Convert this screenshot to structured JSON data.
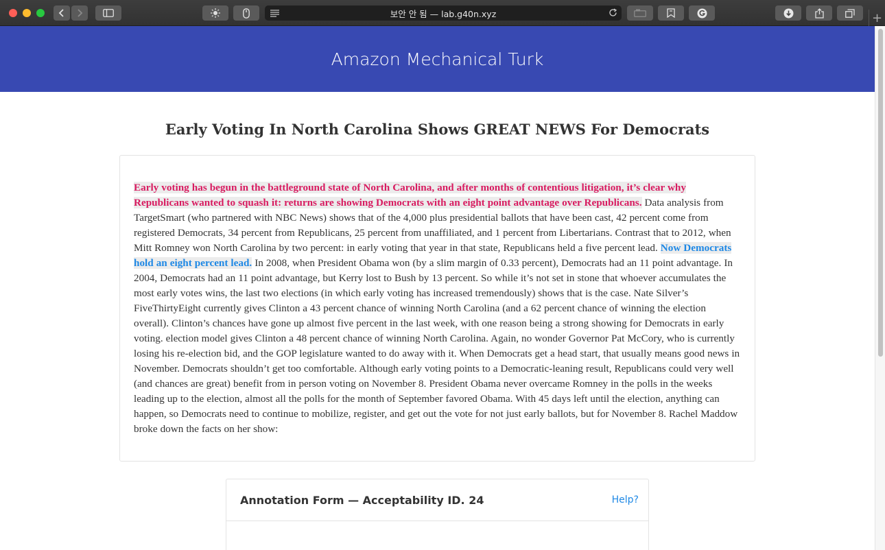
{
  "browser": {
    "url_display": "보안 안 됨 — lab.g40n.xyz",
    "new_tab_label": "+",
    "icons": {
      "back": "chevron-left-icon",
      "forward": "chevron-right-icon",
      "sidebar": "sidebar-icon",
      "brightness": "sun-icon",
      "mouse": "mouse-icon",
      "reader": "reader-lines-icon",
      "reload": "reload-icon",
      "extension_1": "tabs-extension-icon",
      "extension_2": "bookmark-icon",
      "extension_3": "grammarly-icon",
      "download": "download-icon",
      "share": "share-icon",
      "tabs": "tab-overview-icon"
    }
  },
  "page": {
    "banner_title": "Amazon Mechanical Turk",
    "headline": "Early Voting In North Carolina Shows GREAT NEWS For Democrats",
    "article": {
      "highlight_red": "Early voting has begun in the battleground state of North Carolina, and after months of contentious litigation, it’s clear why Republicans wanted to squash it: returns are showing Democrats with an eight point advantage over Republicans.",
      "text_1": " Data analysis from TargetSmart (who partnered with NBC News) shows that of the 4,000 plus presidential ballots that have been cast, 42 percent come from registered Democrats, 34 percent from Republicans, 25 percent from unaffiliated, and 1 percent from Libertarians. Contrast that to 2012, when Mitt Romney won North Carolina by two percent: in early voting that year in that state, Republicans held a five percent lead. ",
      "highlight_blue": "Now Democrats hold an eight percent lead.",
      "text_2": " In 2008, when President Obama won (by a slim margin of 0.33 percent), Democrats had an 11 point advantage. In 2004, Democrats had an 11 point advantage, but Kerry lost to Bush by 13 percent. So while it’s not set in stone that whoever accumulates the most early votes wins, the last two elections (in which early voting has increased tremendously) shows that is the case. Nate Silver’s FiveThirtyEight currently gives Clinton a 43 percent chance of winning North Carolina (and a 62 percent chance of winning the election overall). Clinton’s chances have gone up almost five percent in the last week, with one reason being a strong showing for Democrats in early voting. election model gives Clinton a 48 percent chance of winning North Carolina. Again, no wonder Governor Pat McCory, who is currently losing his re-election bid, and the GOP legislature wanted to do away with it. When Democrats get a head start, that usually means good news in November. Democrats shouldn’t get too comfortable. Although early voting points to a Democratic-leaning result, Republicans could very well (and chances are great) benefit from in person voting on November 8. President Obama never overcame Romney in the polls in the weeks leading up to the election, almost all the polls for the month of September favored Obama. With 45 days left until the election, anything can happen, so Democrats need to continue to mobilize, register, and get out the vote for not just early ballots, but for November 8. Rachel Maddow broke down the facts on her show:"
    },
    "form": {
      "title": "Annotation Form — Acceptability ID. 24",
      "help_label": "Help?"
    }
  },
  "colors": {
    "banner": "#3849b2",
    "highlight_red": "#d81b60",
    "highlight_blue": "#1e88e5",
    "link": "#1e88e5"
  }
}
